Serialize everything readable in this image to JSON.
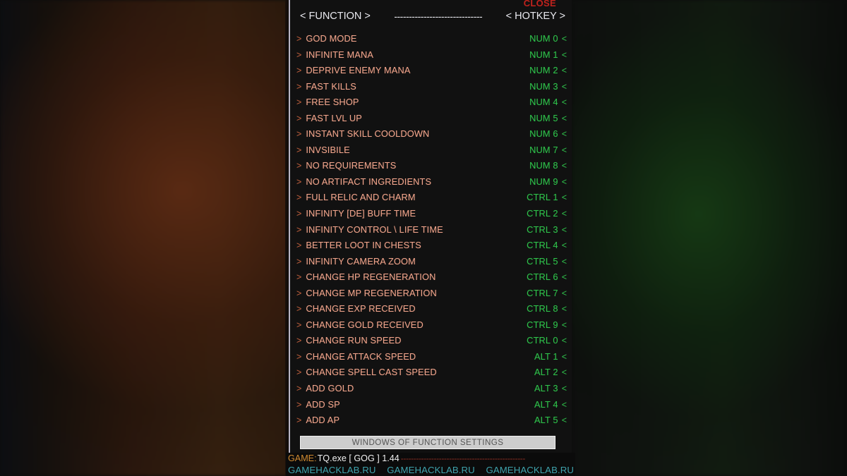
{
  "window": {
    "close_label": "CLOSE",
    "accent_close": "#c0221d",
    "panel_bg": "#111111"
  },
  "header": {
    "function_col": "< FUNCTION >",
    "separator": "------------------------------",
    "hotkey_col": "< HOTKEY >"
  },
  "list": {
    "arrow_left": ">",
    "arrow_right": "<",
    "rows": [
      {
        "label": "GOD MODE",
        "hotkey": "NUM 0"
      },
      {
        "label": "INFINITE MANA",
        "hotkey": "NUM 1"
      },
      {
        "label": "DEPRIVE ENEMY MANA",
        "hotkey": "NUM 2"
      },
      {
        "label": "FAST KILLS",
        "hotkey": "NUM 3"
      },
      {
        "label": "FREE SHOP",
        "hotkey": "NUM 4"
      },
      {
        "label": "FAST LVL UP",
        "hotkey": "NUM 5"
      },
      {
        "label": "INSTANT SKILL COOLDOWN",
        "hotkey": "NUM 6"
      },
      {
        "label": "INVSIBILE",
        "hotkey": "NUM 7"
      },
      {
        "label": "NO REQUIREMENTS",
        "hotkey": "NUM 8"
      },
      {
        "label": "NO ARTIFACT INGREDIENTS",
        "hotkey": "NUM 9"
      },
      {
        "label": "FULL RELIC AND CHARM",
        "hotkey": "CTRL 1"
      },
      {
        "label": "INFINITY [DE] BUFF TIME",
        "hotkey": "CTRL 2"
      },
      {
        "label": "INFINITY CONTROL \\ LIFE TIME",
        "hotkey": "CTRL 3"
      },
      {
        "label": "BETTER LOOT IN CHESTS",
        "hotkey": "CTRL 4"
      },
      {
        "label": "INFINITY CAMERA ZOOM",
        "hotkey": "CTRL 5"
      },
      {
        "label": "CHANGE HP REGENERATION",
        "hotkey": "CTRL 6"
      },
      {
        "label": "CHANGE MP REGENERATION",
        "hotkey": "CTRL 7"
      },
      {
        "label": "CHANGE EXP RECEIVED",
        "hotkey": "CTRL 8"
      },
      {
        "label": "CHANGE GOLD RECEIVED",
        "hotkey": "CTRL 9"
      },
      {
        "label": "CHANGE RUN SPEED",
        "hotkey": "CTRL 0"
      },
      {
        "label": "CHANGE ATTACK SPEED",
        "hotkey": "ALT 1"
      },
      {
        "label": "CHANGE SPELL CAST SPEED",
        "hotkey": "ALT 2"
      },
      {
        "label": "ADD GOLD",
        "hotkey": "ALT 3"
      },
      {
        "label": "ADD SP",
        "hotkey": "ALT 4"
      },
      {
        "label": "ADD AP",
        "hotkey": "ALT 5"
      }
    ],
    "label_color": "#f0a58c",
    "hotkey_color": "#2fc14b"
  },
  "settings_button": {
    "label": "WINDOWS OF FUNCTION SETTINGS"
  },
  "footer": {
    "game_label": "GAME:",
    "game_value": "TQ.exe [ GOG ] 1.44",
    "dashes": "-------------------------------------------------",
    "sites": [
      "GAMEHACKLAB.RU",
      "GAMEHACKLAB.RU",
      "GAMEHACKLAB.RU"
    ],
    "site_color": "#3fa3ad"
  }
}
